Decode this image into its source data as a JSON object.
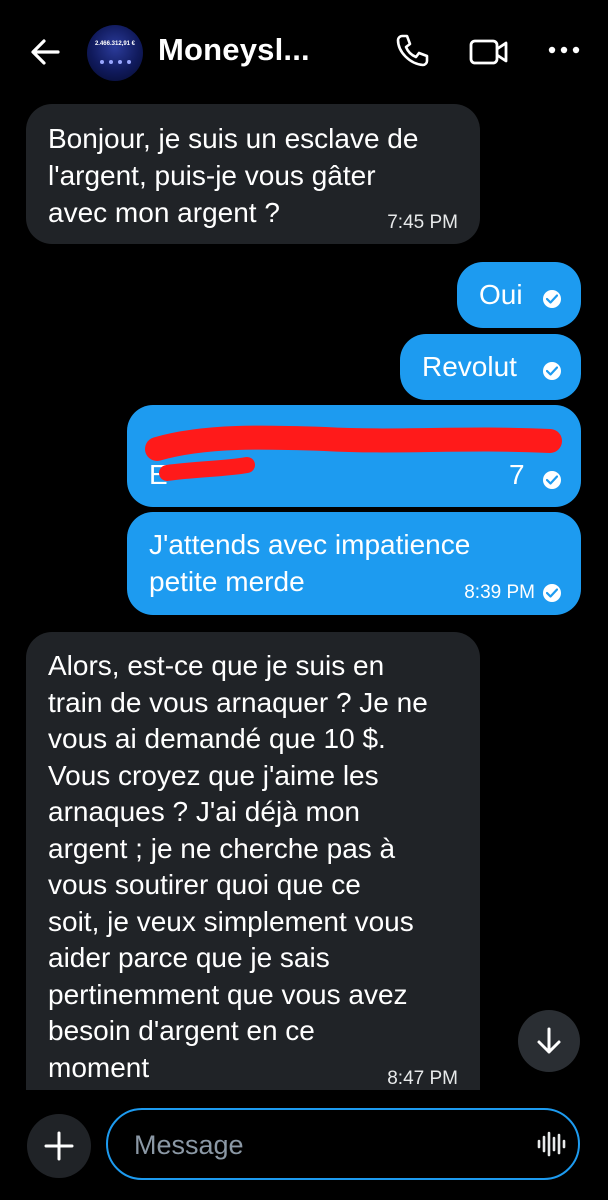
{
  "header": {
    "contact_name": "Moneysl...",
    "avatar_amount": "2.466.312,91 €"
  },
  "messages": [
    {
      "direction": "incoming",
      "text": "Bonjour, je suis un esclave de\nl'argent, puis-je vous gâter\navec mon argent ?",
      "time": "7:45 PM"
    },
    {
      "direction": "outgoing",
      "text": "Oui",
      "time": ""
    },
    {
      "direction": "outgoing",
      "text": "Revolut",
      "time": ""
    },
    {
      "direction": "outgoing",
      "text": "[redacted]",
      "time": ""
    },
    {
      "direction": "outgoing",
      "text": "J'attends avec impatience\npetite merde",
      "time": "8:39 PM"
    },
    {
      "direction": "incoming",
      "text": "Alors, est-ce que je suis en\ntrain de vous arnaquer ? Je ne\nvous ai demandé que 10 $.\nVous croyez que j'aime les\narnaques ? J'ai déjà mon\nargent ; je ne cherche pas à\nvous soutirer quoi que ce\nsoit, je veux simplement vous\naider parce que je sais\npertinemment que vous avez\nbesoin d'argent en ce\nmoment",
      "time": "8:47 PM"
    }
  ],
  "composer": {
    "placeholder": "Message"
  },
  "colors": {
    "background": "#000000",
    "incoming_bubble": "#202327",
    "outgoing_bubble": "#1d9bf0",
    "redaction": "#ff1a1a"
  },
  "icons": [
    "back-arrow-icon",
    "phone-icon",
    "video-camera-icon",
    "more-icon",
    "read-check-icon",
    "scroll-down-arrow-icon",
    "plus-icon",
    "voice-waveform-icon"
  ]
}
